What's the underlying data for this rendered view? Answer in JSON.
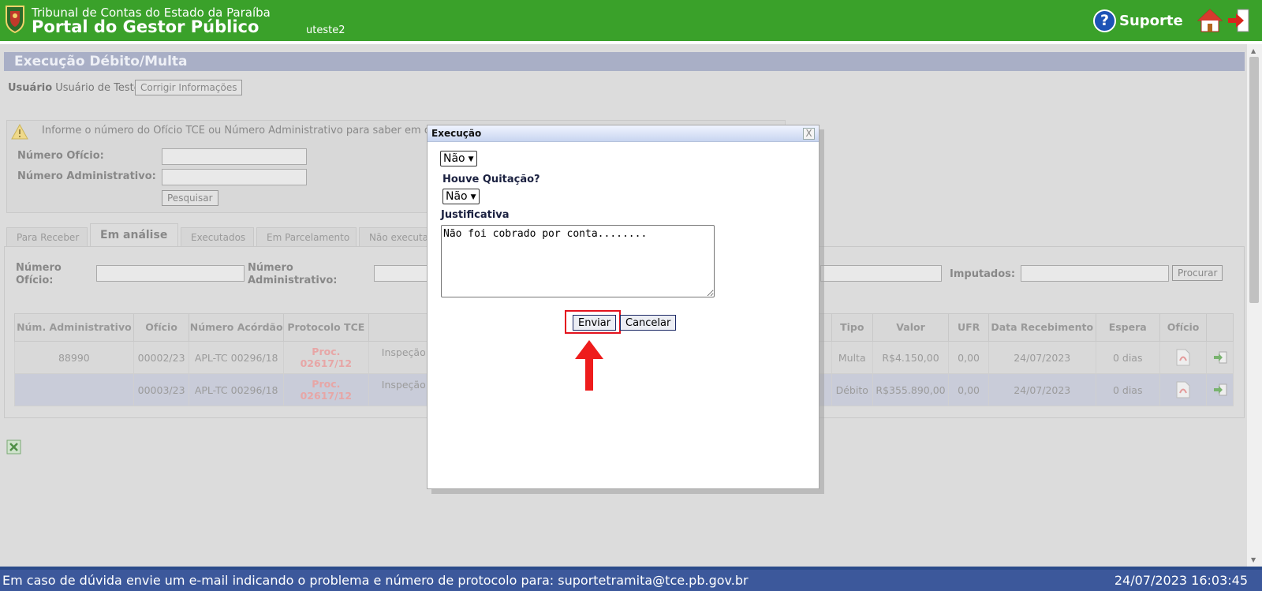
{
  "header": {
    "org_name": "Tribunal de Contas do Estado da Paraíba",
    "portal_name": "Portal do Gestor Público",
    "username": "uteste2",
    "support_label": "Suporte",
    "help_glyph": "?",
    "icons": {
      "crest": "crest-logo-icon",
      "help": "help-icon",
      "home": "home-icon",
      "exit": "exit-icon"
    }
  },
  "page": {
    "title": "Execução Débito/Multa",
    "user_label": "Usuário",
    "user_value": "Usuário de Teste",
    "fix_button": "Corrigir Informações",
    "info_text": "Informe o número do Ofício TCE ou Número Administrativo para saber em que s",
    "oficio_label": "Número Ofício:",
    "admin_label": "Número Administrativo:",
    "search_button": "Pesquisar",
    "tabs": [
      {
        "label": "Para Receber",
        "active": false
      },
      {
        "label": "Em análise",
        "active": true
      },
      {
        "label": "Executados",
        "active": false
      },
      {
        "label": "Em Parcelamento",
        "active": false
      },
      {
        "label": "Não executa",
        "active": false
      }
    ],
    "filters": {
      "oficio_label": "Número Ofício:",
      "admin_label": "Número Administrativo:",
      "imputados_label": "Imputados:",
      "search_button": "Procurar"
    },
    "table": {
      "headers": [
        "Núm. Administrativo",
        "Ofício",
        "Número Acórdão",
        "Protocolo TCE",
        "",
        "Tipo",
        "Valor",
        "UFR",
        "Data Recebimento",
        "Espera",
        "Ofício",
        ""
      ],
      "rows": [
        {
          "admin": "88990",
          "oficio": "00002/23",
          "acordao": "APL-TC 00296/18",
          "proc1": "Proc.",
          "proc2": "02617/12",
          "desc": "Inspeção",
          "tipo": "Multa",
          "valor": "R$4.150,00",
          "ufr": "0,00",
          "data": "24/07/2023",
          "espera": "0 dias"
        },
        {
          "admin": "",
          "oficio": "00003/23",
          "acordao": "APL-TC 00296/18",
          "proc1": "Proc.",
          "proc2": "02617/12",
          "desc": "Inspeção",
          "tipo": "Débito",
          "valor": "R$355.890,00",
          "ufr": "0,00",
          "data": "24/07/2023",
          "espera": "0 dias"
        }
      ]
    }
  },
  "modal": {
    "title": "Execução",
    "close_glyph": "X",
    "select1_value": "Não",
    "quitacao_label": "Houve Quitação?",
    "quitacao_value": "Não",
    "justificativa_label": "Justificativa",
    "justificativa_value": "Não foi cobrado por conta........",
    "send_button": "Enviar",
    "cancel_button": "Cancelar",
    "highlight_color": "#e3121d"
  },
  "footer": {
    "message": "Em caso de dúvida envie um e-mail indicando o problema e número de protocolo para: suportetramita@tce.pb.gov.br",
    "datetime": "24/07/2023 16:03:45"
  },
  "colors": {
    "header_green": "#3aa12a",
    "footer_blue": "#3c589b",
    "title_bar": "#a9afc6"
  }
}
